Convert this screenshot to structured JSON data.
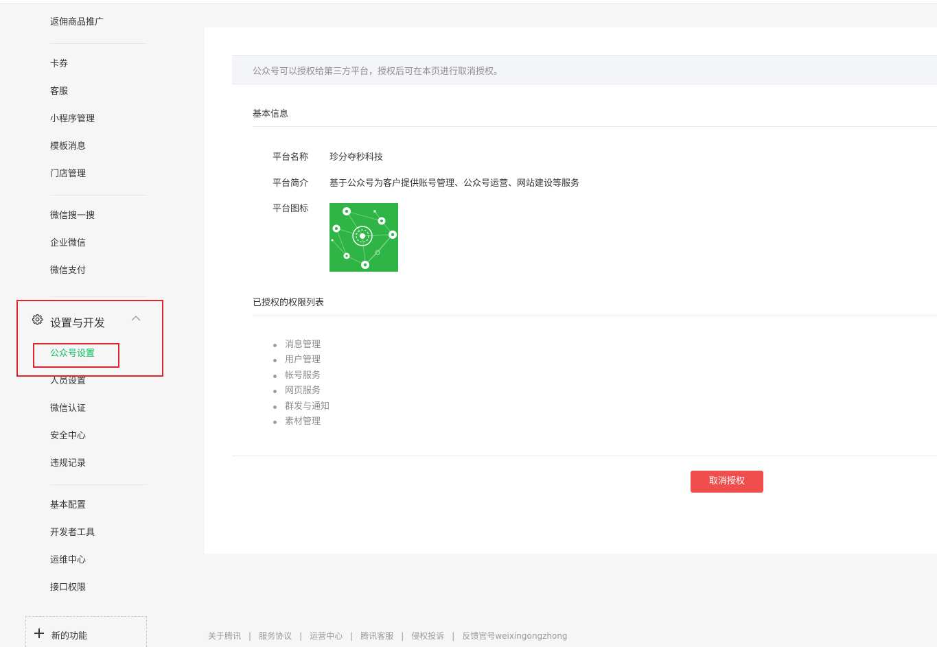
{
  "sidebar": {
    "items_top": [
      {
        "label": "返佣商品推广"
      },
      {
        "label": "卡券"
      },
      {
        "label": "客服"
      },
      {
        "label": "小程序管理"
      },
      {
        "label": "模板消息"
      },
      {
        "label": "门店管理"
      },
      {
        "label": "微信搜一搜"
      },
      {
        "label": "企业微信"
      },
      {
        "label": "微信支付"
      }
    ],
    "group": {
      "title": "设置与开发",
      "icon": "gear-icon",
      "expand_icon": "chevron-up-icon"
    },
    "items_group": [
      {
        "label": "公众号设置",
        "active": true
      },
      {
        "label": "人员设置"
      },
      {
        "label": "微信认证"
      },
      {
        "label": "安全中心"
      },
      {
        "label": "违规记录"
      },
      {
        "label": "基本配置"
      },
      {
        "label": "开发者工具"
      },
      {
        "label": "运维中心"
      },
      {
        "label": "接口权限"
      }
    ],
    "new_feature": {
      "label": "新的功能",
      "icon": "plus-icon"
    },
    "active_color": "#07c160",
    "highlight_color": "#e0242e"
  },
  "main": {
    "notice": "公众号可以授权给第三方平台，授权后可在本页进行取消授权。",
    "basic_info": {
      "title": "基本信息",
      "name_label": "平台名称",
      "name_value": "珍分夺秒科技",
      "intro_label": "平台简介",
      "intro_value": "基于公众号为客户提供账号管理、公众号运营、网站建设等服务",
      "icon_label": "平台图标",
      "icon_color": "#2fb545"
    },
    "permissions": {
      "title": "已授权的权限列表",
      "items": [
        "消息管理",
        "用户管理",
        "帐号服务",
        "网页服务",
        "群发与通知",
        "素材管理"
      ]
    },
    "cancel_button": {
      "label": "取消授权",
      "color": "#f04d4d"
    }
  },
  "footer": {
    "links": [
      "关于腾讯",
      "服务协议",
      "运营中心",
      "腾讯客服",
      "侵权投诉",
      "反馈官号weixingongzhong"
    ]
  }
}
